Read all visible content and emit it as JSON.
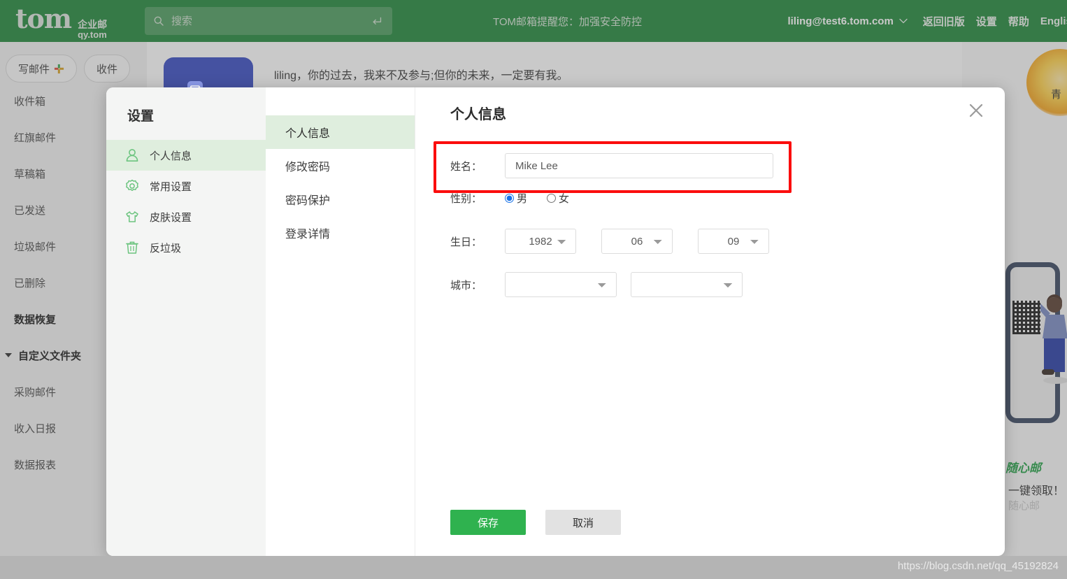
{
  "header": {
    "brand_name": "tom",
    "brand_line1": "企业邮",
    "brand_line2": "qy.tom",
    "search_placeholder": "搜索",
    "search_value": "",
    "tip": "TOM邮箱提醒您：加强安全防控",
    "account_email": "liling@test6.tom.com",
    "links": [
      {
        "label": "返回旧版"
      },
      {
        "label": "设置"
      },
      {
        "label": "帮助"
      },
      {
        "label": "English"
      }
    ]
  },
  "sidebar": {
    "compose_label": "写邮件",
    "receive_label": "收件",
    "folders": [
      {
        "label": "收件箱",
        "bold": false
      },
      {
        "label": "红旗邮件",
        "bold": false
      },
      {
        "label": "草稿箱",
        "bold": false
      },
      {
        "label": "已发送",
        "bold": false
      },
      {
        "label": "垃圾邮件",
        "bold": false
      },
      {
        "label": "已删除",
        "bold": false
      },
      {
        "label": "数据恢复",
        "bold": true
      }
    ],
    "custom_folder_label": "自定义文件夹",
    "custom_folders": [
      {
        "label": "采购邮件"
      },
      {
        "label": "收入日报"
      },
      {
        "label": "数据报表"
      }
    ]
  },
  "main": {
    "greeting": "liling，你的过去，我来不及参与;但你的未来，一定要有我。"
  },
  "promo": {
    "side_word": "青",
    "title": "随心邮",
    "subtitle": "一键领取！",
    "faded": "随心邮"
  },
  "modal": {
    "nav_title": "设置",
    "nav_items": [
      {
        "label": "个人信息",
        "icon": "person-icon",
        "active": true
      },
      {
        "label": "常用设置",
        "icon": "gear-icon",
        "active": false
      },
      {
        "label": "皮肤设置",
        "icon": "tshirt-icon",
        "active": false
      },
      {
        "label": "反垃圾",
        "icon": "trash-icon",
        "active": false
      }
    ],
    "sub_items": [
      {
        "label": "个人信息",
        "active": true
      },
      {
        "label": "修改密码",
        "active": false
      },
      {
        "label": "密码保护",
        "active": false
      },
      {
        "label": "登录详情",
        "active": false
      }
    ],
    "panel_title": "个人信息",
    "form": {
      "name_label": "姓名：",
      "name_value": "Mike Lee",
      "name_placeholder": "",
      "gender_label": "性别：",
      "gender_male": "男",
      "gender_female": "女",
      "gender_selected": "男",
      "birthday_label": "生日：",
      "birth_year": "1982",
      "birth_month": "06",
      "birth_day": "09",
      "city_label": "城市：",
      "city_province": "",
      "city_city": ""
    },
    "save_label": "保存",
    "cancel_label": "取消"
  },
  "watermark": "https://blog.csdn.net/qq_45192824",
  "colors": {
    "header_green": "#258a3e",
    "accent_green": "#2fb24f",
    "highlight_red": "#fb0d0d",
    "radio_blue": "#1a73e8",
    "nav_active_bg": "#dfeede"
  }
}
